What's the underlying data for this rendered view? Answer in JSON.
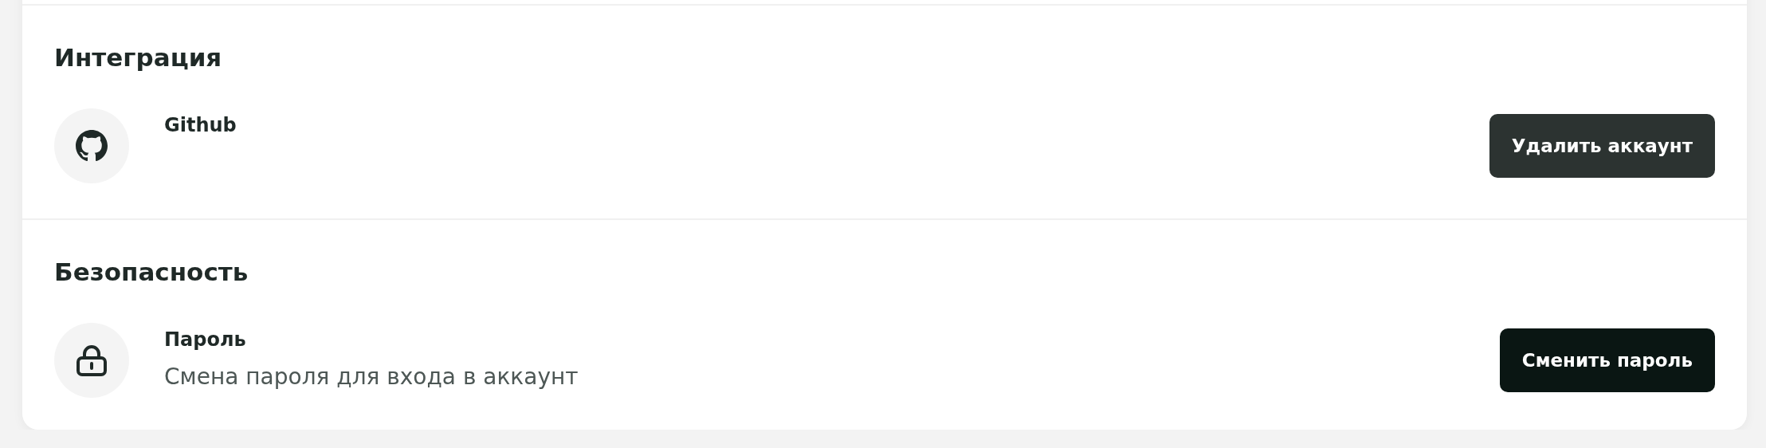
{
  "sections": [
    {
      "title": "Интеграция",
      "item": {
        "kind": "github",
        "name": "Github",
        "button": {
          "label": "Удалить аккаунт",
          "kind": "secondary"
        }
      }
    },
    {
      "title": "Безопасность",
      "item": {
        "kind": "lock",
        "name": "Пароль",
        "description": "Смена пароля для входа в аккаунт",
        "button": {
          "label": "Сменить пароль",
          "kind": "primary"
        }
      }
    }
  ]
}
